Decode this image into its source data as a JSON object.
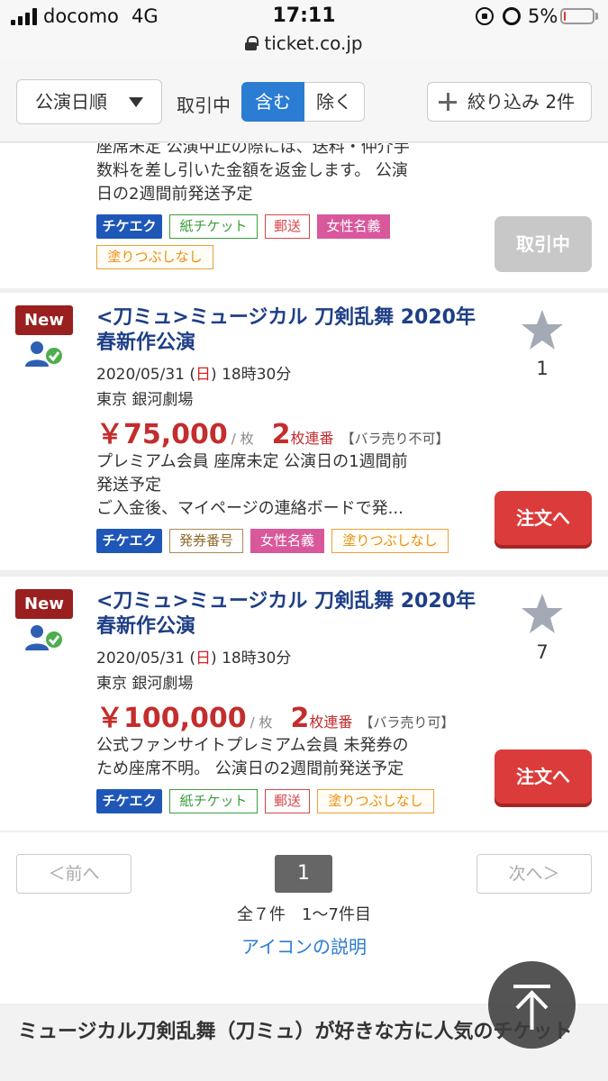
{
  "status_bar": {
    "carrier": "docomo",
    "network": "4G",
    "time": "17:11",
    "battery_percent": "5%",
    "battery_level": 0.05,
    "url": "ticket.co.jp"
  },
  "filter_bar": {
    "sort_label": "公演日順",
    "trade_label": "取引中",
    "include_label": "含む",
    "exclude_label": "除く",
    "filter_label": "絞り込み 2件"
  },
  "partial_listing": {
    "desc_lines": [
      "座席未定 公演中止の際には、送料・仲介手",
      "数料を差し引いた金額を返金します。 公演",
      "日の2週間前発送予定"
    ],
    "tags": [
      "チケエク",
      "紙チケット",
      "郵送",
      "女性名義",
      "塗りつぶしなし"
    ],
    "status_button": "取引中"
  },
  "listings": [
    {
      "new_label": "New",
      "title": "<刀ミュ>ミュージカル 刀剣乱舞 2020年春新作公演",
      "date": "2020/05/31",
      "weekday_open": "(",
      "weekday": "日",
      "weekday_close": ")",
      "time": "18時30分",
      "venue": "東京 銀河劇場",
      "price": "￥75,000",
      "unit": "/ 枚",
      "quantity": "2",
      "quantity_label": "枚連番",
      "split": "【バラ売り不可】",
      "desc_lines": [
        "プレミアム会員 座席未定 公演日の1週間前",
        "発送予定",
        "ご入金後、マイページの連絡ボードで発..."
      ],
      "tags": [
        "チケエク",
        "発券番号",
        "女性名義",
        "塗りつぶしなし"
      ],
      "favorites": "1",
      "order_button": "注文へ"
    },
    {
      "new_label": "New",
      "title": "<刀ミュ>ミュージカル 刀剣乱舞 2020年春新作公演",
      "date": "2020/05/31",
      "weekday_open": "(",
      "weekday": "日",
      "weekday_close": ")",
      "time": "18時30分",
      "venue": "東京 銀河劇場",
      "price": "￥100,000",
      "unit": "/ 枚",
      "quantity": "2",
      "quantity_label": "枚連番",
      "split": "【バラ売り可】",
      "desc_lines": [
        "公式ファンサイトプレミアム会員  未発券の",
        "ため座席不明。 公演日の2週間前発送予定"
      ],
      "tags": [
        "チケエク",
        "紙チケット",
        "郵送",
        "塗りつぶしなし"
      ],
      "favorites": "7",
      "order_button": "注文へ"
    }
  ],
  "pagination": {
    "prev_label": "＜前へ",
    "next_label": "次へ＞",
    "current_page": "1",
    "summary": "全７件　1〜7件目",
    "icon_help_link": "アイコンの説明"
  },
  "related": {
    "title": "ミュージカル刀剣乱舞（刀ミュ）が好きな方に人気のチケット"
  },
  "colors": {
    "accent_blue": "#2b7cd3",
    "order_red": "#dc3b3b",
    "price_red": "#c42d2d",
    "title_navy": "#1e3f86",
    "new_badge": "#9a2020"
  }
}
